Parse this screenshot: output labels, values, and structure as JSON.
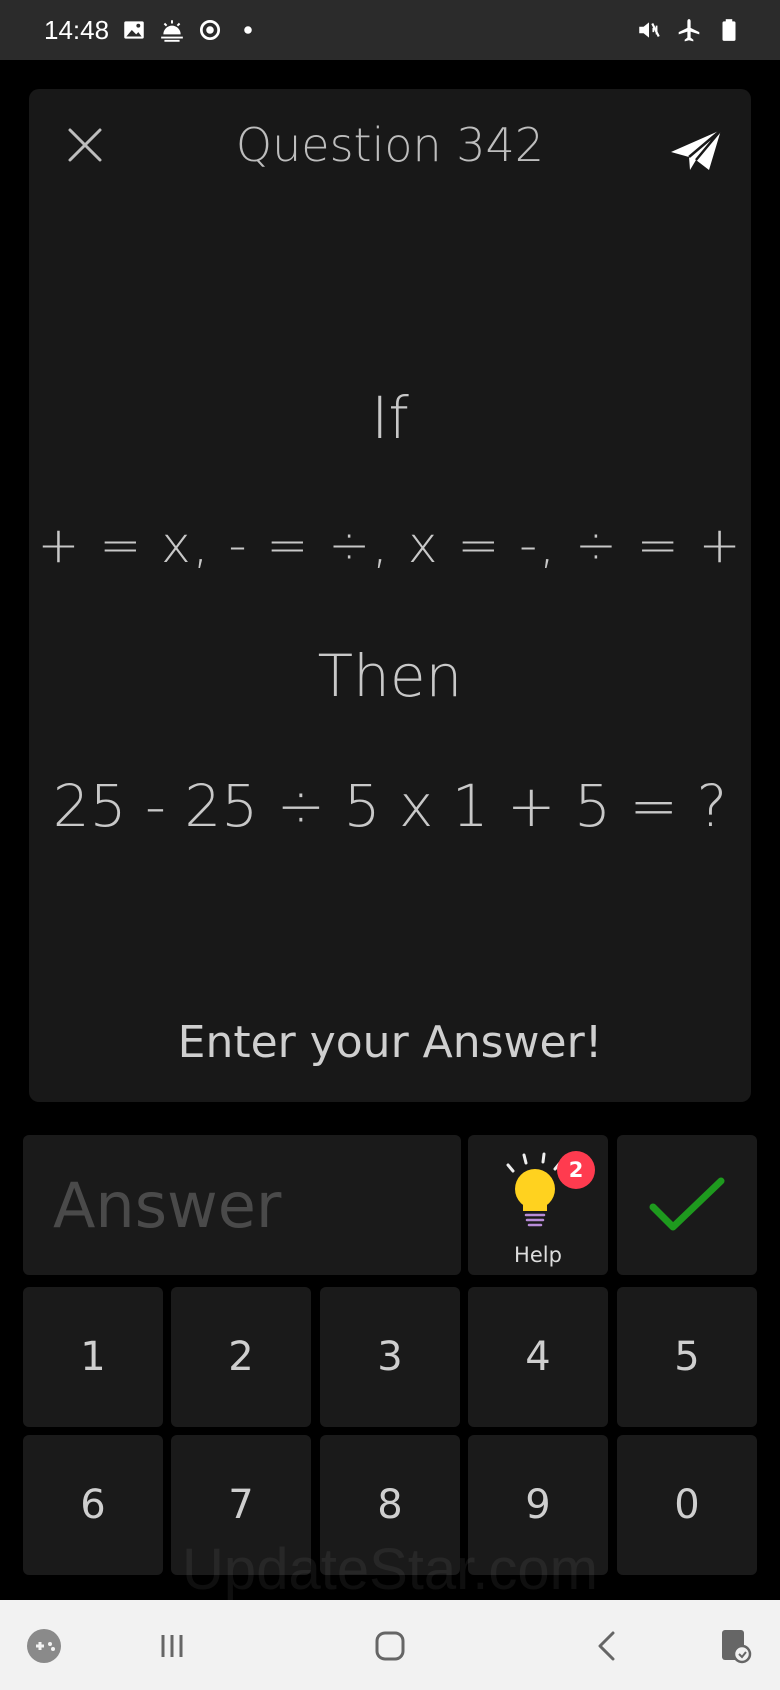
{
  "status_bar": {
    "time": "14:48",
    "icons_left": [
      "gallery-icon",
      "weather-icon",
      "sync-icon",
      "dot-icon"
    ],
    "icons_right": [
      "mute-vibrate-icon",
      "airplane-mode-icon",
      "battery-icon"
    ]
  },
  "header": {
    "title": "Question 342",
    "close_icon": "close-icon",
    "share_icon": "paper-plane-icon"
  },
  "question": {
    "line1": "If",
    "line2": "+ = x, - = ÷, x = -, ÷ = +",
    "line3": "Then",
    "line4": "25 - 25 ÷ 5 x 1 + 5 = ?"
  },
  "prompt": "Enter your Answer!",
  "answer": {
    "placeholder": "Answer",
    "value": ""
  },
  "help": {
    "label": "Help",
    "badge": "2",
    "icon": "lightbulb-icon"
  },
  "submit": {
    "icon": "checkmark-icon",
    "color": "#1e9a1e"
  },
  "keypad": {
    "keys": [
      "1",
      "2",
      "3",
      "4",
      "5",
      "6",
      "7",
      "8",
      "9",
      "0"
    ]
  },
  "watermark": "UpdateStar.com",
  "nav_bar": {
    "items": [
      "game-launcher-icon",
      "recent-apps-icon",
      "home-icon",
      "back-icon",
      "screen-touch-icon"
    ]
  },
  "colors": {
    "background": "#000000",
    "card": "#181818",
    "badge": "#ff3b4f",
    "bulb": "#ffd21f"
  }
}
